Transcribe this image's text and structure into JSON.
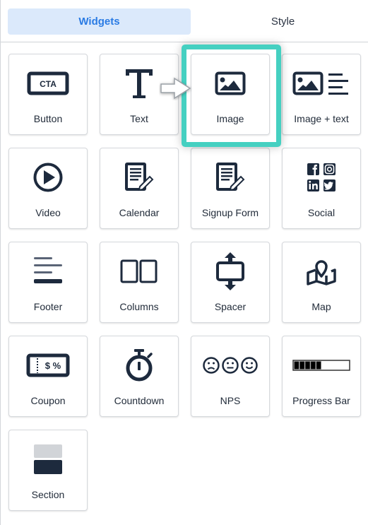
{
  "tabs": [
    {
      "label": "Widgets",
      "active": true
    },
    {
      "label": "Style",
      "active": false
    }
  ],
  "widgets": [
    {
      "label": "Button",
      "icon": "cta-button-icon",
      "icon_text": "CTA"
    },
    {
      "label": "Text",
      "icon": "text-t-icon"
    },
    {
      "label": "Image",
      "icon": "image-icon",
      "highlighted": true
    },
    {
      "label": "Image + text",
      "icon": "image-text-icon"
    },
    {
      "label": "Video",
      "icon": "play-circle-icon"
    },
    {
      "label": "Calendar",
      "icon": "document-pen-icon"
    },
    {
      "label": "Signup Form",
      "icon": "document-pen-icon"
    },
    {
      "label": "Social",
      "icon": "social-icons-icon"
    },
    {
      "label": "Footer",
      "icon": "footer-lines-icon"
    },
    {
      "label": "Columns",
      "icon": "columns-icon"
    },
    {
      "label": "Spacer",
      "icon": "spacer-arrows-icon"
    },
    {
      "label": "Map",
      "icon": "map-pin-icon"
    },
    {
      "label": "Coupon",
      "icon": "coupon-ticket-icon",
      "icon_text": "$ %"
    },
    {
      "label": "Countdown",
      "icon": "stopwatch-icon"
    },
    {
      "label": "NPS",
      "icon": "smiley-faces-icon"
    },
    {
      "label": "Progress Bar",
      "icon": "progress-bar-icon",
      "progress_fraction": 0.5
    },
    {
      "label": "Section",
      "icon": "section-blocks-icon"
    }
  ],
  "colors": {
    "accent": "#2a7be4",
    "active_tab_bg": "#dbe9fb",
    "highlight": "#45d0c1",
    "icon": "#1d2a3d"
  }
}
